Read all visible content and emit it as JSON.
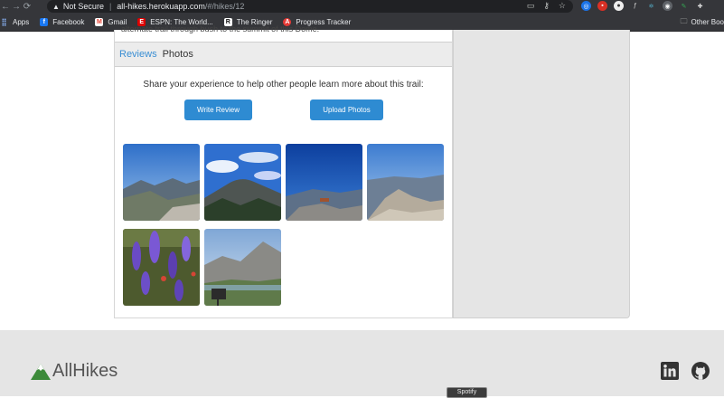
{
  "browser": {
    "security_label": "Not Secure",
    "url_host": "all-hikes.herokuapp.com",
    "url_path": "/#/hikes/12",
    "bookmarks": [
      {
        "label": "Apps",
        "color": "#8ab4f8"
      },
      {
        "label": "Facebook",
        "color": "#1877f2"
      },
      {
        "label": "Gmail",
        "color": "#ea4335"
      },
      {
        "label": "ESPN: The World...",
        "color": "#d00"
      },
      {
        "label": "The Ringer",
        "color": "#111"
      },
      {
        "label": "Progress Tracker",
        "color": "#e53935"
      }
    ],
    "other_bookmarks": "Other Boo"
  },
  "trail": {
    "cut_description": "alternate trail through bush to the summit of this Dome.",
    "tabs": {
      "reviews": "Reviews",
      "photos": "Photos"
    },
    "prompt": "Share your experience to help other people learn more about this trail:",
    "write_review_label": "Write Review",
    "upload_photos_label": "Upload Photos"
  },
  "footer": {
    "brand": "AllHikes",
    "brand_color": "#3c8a3a",
    "tooltip": "Spotify"
  }
}
